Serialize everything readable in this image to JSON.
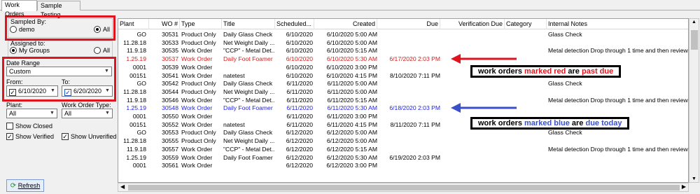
{
  "tabs": [
    "Work Orders",
    "Sample Testing"
  ],
  "filters": {
    "sampled_by_label": "Sampled By:",
    "sampled_by_options": [
      "demo",
      "All"
    ],
    "assigned_to_label": "Assigned to:",
    "assigned_to_options": [
      "My Groups",
      "All"
    ],
    "date_range_label": "Date Range",
    "date_range_value": "Custom",
    "from_label": "From:",
    "from_value": "6/10/2020",
    "to_label": "To:",
    "to_value": "6/20/2020",
    "plant_label": "Plant:",
    "plant_value": "All",
    "wo_type_label": "Work Order Type:",
    "wo_type_value": "All",
    "show_closed": "Show Closed",
    "show_verified": "Show Verified",
    "show_unverified": "Show Unverified",
    "refresh": "Refresh"
  },
  "table": {
    "headers": [
      "Plant",
      "WO #",
      "Type",
      "Title",
      "Scheduled...",
      "Created",
      "Due",
      "Verification Due",
      "Category",
      "Internal Notes"
    ],
    "rows": [
      {
        "plant": "GO",
        "wo": "30531",
        "type": "Product Only",
        "title": "Daily Glass Check",
        "sched": "6/10/2020",
        "created": "6/10/2020 5:00 AM",
        "due": "",
        "vdue": "",
        "cat": "",
        "notes": "Glass Check",
        "status": ""
      },
      {
        "plant": "11.28.18",
        "wo": "30533",
        "type": "Product Only",
        "title": "Net Weight Daily ...",
        "sched": "6/10/2020",
        "created": "6/10/2020 5:00 AM",
        "due": "",
        "vdue": "",
        "cat": "",
        "notes": "",
        "status": ""
      },
      {
        "plant": "11.9.18",
        "wo": "30535",
        "type": "Work Order",
        "title": "\"CCP\" - Metal Det...",
        "sched": "6/10/2020",
        "created": "6/10/2020 5:15 AM",
        "due": "",
        "vdue": "",
        "cat": "",
        "notes": "Metal detection Drop through 1 time and then review.",
        "status": ""
      },
      {
        "plant": "1.25.19",
        "wo": "30537",
        "type": "Work Order",
        "title": "Daily Foot Foamer",
        "sched": "6/10/2020",
        "created": "6/10/2020 5:30 AM",
        "due": "6/17/2020 2:03 PM",
        "vdue": "",
        "cat": "",
        "notes": "",
        "status": "red"
      },
      {
        "plant": "0001",
        "wo": "30539",
        "type": "Work Order",
        "title": "",
        "sched": "6/10/2020",
        "created": "6/10/2020 3:00 PM",
        "due": "",
        "vdue": "",
        "cat": "",
        "notes": "",
        "status": ""
      },
      {
        "plant": "00151",
        "wo": "30541",
        "type": "Work Order",
        "title": "natetest",
        "sched": "6/10/2020",
        "created": "6/10/2020 4:15 PM",
        "due": "8/10/2020 7:11 PM",
        "vdue": "",
        "cat": "",
        "notes": "",
        "status": ""
      },
      {
        "plant": "GO",
        "wo": "30542",
        "type": "Product Only",
        "title": "Daily Glass Check",
        "sched": "6/11/2020",
        "created": "6/11/2020 5:00 AM",
        "due": "",
        "vdue": "",
        "cat": "",
        "notes": "Glass Check",
        "status": ""
      },
      {
        "plant": "11.28.18",
        "wo": "30544",
        "type": "Product Only",
        "title": "Net Weight Daily ...",
        "sched": "6/11/2020",
        "created": "6/11/2020 5:00 AM",
        "due": "",
        "vdue": "",
        "cat": "",
        "notes": "",
        "status": ""
      },
      {
        "plant": "11.9.18",
        "wo": "30546",
        "type": "Work Order",
        "title": "\"CCP\" - Metal Det...",
        "sched": "6/11/2020",
        "created": "6/11/2020 5:15 AM",
        "due": "",
        "vdue": "",
        "cat": "",
        "notes": "Metal detection Drop through 1 time and then review.",
        "status": ""
      },
      {
        "plant": "1.25.19",
        "wo": "30548",
        "type": "Work Order",
        "title": "Daily Foot Foamer",
        "sched": "6/11/2020",
        "created": "6/11/2020 5:30 AM",
        "due": "6/18/2020 2:03 PM",
        "vdue": "",
        "cat": "",
        "notes": "",
        "status": "blue"
      },
      {
        "plant": "0001",
        "wo": "30550",
        "type": "Work Order",
        "title": "",
        "sched": "6/11/2020",
        "created": "6/11/2020 3:00 PM",
        "due": "",
        "vdue": "",
        "cat": "",
        "notes": "",
        "status": ""
      },
      {
        "plant": "00151",
        "wo": "30552",
        "type": "Work Order",
        "title": "natetest",
        "sched": "6/11/2020",
        "created": "6/11/2020 4:15 PM",
        "due": "8/11/2020 7:11 PM",
        "vdue": "",
        "cat": "",
        "notes": "",
        "status": ""
      },
      {
        "plant": "GO",
        "wo": "30553",
        "type": "Product Only",
        "title": "Daily Glass Check",
        "sched": "6/12/2020",
        "created": "6/12/2020 5:00 AM",
        "due": "",
        "vdue": "",
        "cat": "",
        "notes": "Glass Check",
        "status": ""
      },
      {
        "plant": "11.28.18",
        "wo": "30555",
        "type": "Product Only",
        "title": "Net Weight Daily ...",
        "sched": "6/12/2020",
        "created": "6/12/2020 5:00 AM",
        "due": "",
        "vdue": "",
        "cat": "",
        "notes": "",
        "status": ""
      },
      {
        "plant": "11.9.18",
        "wo": "30557",
        "type": "Work Order",
        "title": "\"CCP\" - Metal Det...",
        "sched": "6/12/2020",
        "created": "6/12/2020 5:15 AM",
        "due": "",
        "vdue": "",
        "cat": "",
        "notes": "Metal detection Drop through 1 time and then review.",
        "status": ""
      },
      {
        "plant": "1.25.19",
        "wo": "30559",
        "type": "Work Order",
        "title": "Daily Foot Foamer",
        "sched": "6/12/2020",
        "created": "6/12/2020 5:30 AM",
        "due": "6/19/2020 2:03 PM",
        "vdue": "",
        "cat": "",
        "notes": "",
        "status": ""
      },
      {
        "plant": "0001",
        "wo": "30561",
        "type": "Work Order",
        "title": "",
        "sched": "6/12/2020",
        "created": "6/12/2020 3:00 PM",
        "due": "",
        "vdue": "",
        "cat": "",
        "notes": "",
        "status": ""
      }
    ]
  },
  "annotations": {
    "red_note": {
      "pre": "work orders ",
      "mid": "marked red",
      "post": " are ",
      "end": "past due",
      "color": "#e0141e"
    },
    "blue_note": {
      "pre": "work orders ",
      "mid": "marked blue",
      "post": " are ",
      "end": "due today",
      "color": "#3a50c8"
    }
  }
}
